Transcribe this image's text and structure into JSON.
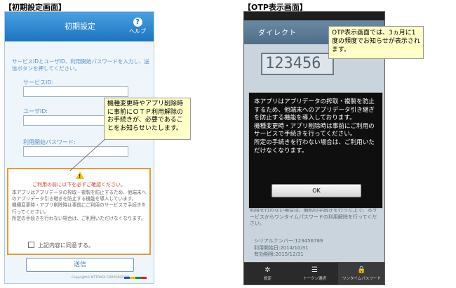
{
  "left_section": {
    "title": "【初期設定画面】",
    "header_title": "初期設定",
    "help_label": "ヘルプ",
    "intro_text": "サービスIDとユーザID、利用開始パスワードを入力し、送信ボタンを押してください。",
    "fields": [
      {
        "label": "サービスID:",
        "value": ""
      },
      {
        "label": "ユーザID:",
        "value": ""
      },
      {
        "label": "利用開始パスワード:",
        "value": ""
      }
    ],
    "warning_title": "ご利用の前に以下を必ずご確認ください。",
    "warning_body": [
      "本アプリはアプリデータの搾取・複製を防止するため、他端末へのアプリデータ引き継ぎを防止する機能を導入しています。",
      "機種変更時・アプリ削除時は事前にご利用のサービスで手続きを行ってください。",
      "所定の手続きを行わない場合は、ご利用いただけなくなります。"
    ],
    "agree_label": "上記内容に同意する。",
    "send_label": "送信",
    "copyright": "Copyright© NTTDATA CORPORATION",
    "callout": "機種変更時やアプリ削除時に事前にＯＴＰ利用解除のお手続きが、必要であることをお知らせいたします。"
  },
  "right_section": {
    "title": "【OTP表示画面】",
    "header_title": "ダイレクト",
    "otp_value": "123456",
    "background_text": "利用を行わない場合は、解約の手続きを行った上で、本サービスからワンタイムパスワードの利用解除を行ってください。",
    "serial_lines": [
      "シリアルナンバー:123456789",
      "利用開始日:2014/10/31",
      "有効期限:2015/12/31"
    ],
    "modal_lines": [
      "本アプリはアプリデータの搾取・複製を防止するため、他端末へのアプリデータ引き継ぎを防止する機能を導入しております。",
      "機種変更時・アプリ削除時は事前にご利用のサービスで手続きを行ってください。",
      "所定の手続きを行わない場合は、ご利用いただけなくなります。"
    ],
    "ok_label": "OK",
    "tabs": [
      {
        "label": "設定",
        "icon": "gear-icon"
      },
      {
        "label": "トークン選択",
        "icon": "list-icon"
      },
      {
        "label": "ワンタイムパスワード",
        "icon": "lock-icon"
      }
    ],
    "callout": "OTP表示画面では、3ヵ月に1度の頻度でお知らせが表示されます。"
  },
  "colors": {
    "header_blue": "#1c73c2",
    "warning_border": "#e39b3a",
    "warning_red": "#d23c2c",
    "callout_bg": "#ffffc8"
  }
}
